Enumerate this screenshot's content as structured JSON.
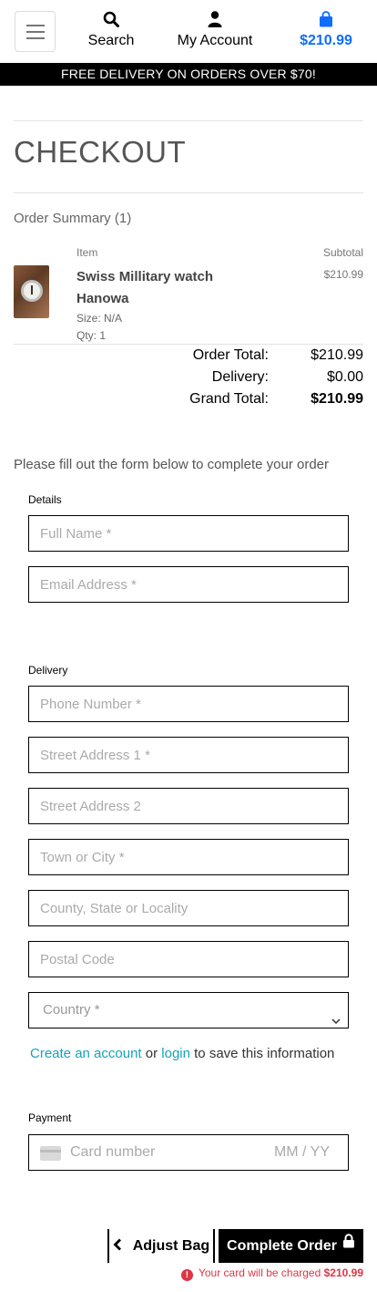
{
  "header": {
    "search_label": "Search",
    "account_label": "My Account",
    "bag_total": "$210.99"
  },
  "banner": {
    "text": "FREE DELIVERY ON ORDERS OVER $70!"
  },
  "page": {
    "title": "CHECKOUT"
  },
  "summary": {
    "title": "Order Summary (1)",
    "item_header": "Item",
    "subtotal_header": "Subtotal",
    "item": {
      "name": "Swiss Millitary watch Hanowa",
      "price": "$210.99",
      "size": "Size: N/A",
      "qty": "Qty: 1"
    },
    "order_total_label": "Order Total:",
    "order_total_value": "$210.99",
    "delivery_label": "Delivery:",
    "delivery_value": "$0.00",
    "grand_total_label": "Grand Total:",
    "grand_total_value": "$210.99"
  },
  "form": {
    "intro": "Please fill out the form below to complete your order",
    "details_label": "Details",
    "full_name_placeholder": "Full Name *",
    "email_placeholder": "Email Address *",
    "delivery_label": "Delivery",
    "phone_placeholder": "Phone Number *",
    "street1_placeholder": "Street Address 1 *",
    "street2_placeholder": "Street Address 2",
    "town_placeholder": "Town or City *",
    "county_placeholder": "County, State or Locality",
    "postcode_placeholder": "Postal Code",
    "country_selected": "Country *",
    "account_link": "Create an account",
    "or_text": "or",
    "login_link": "login",
    "save_text": "to save this information",
    "payment_label": "Payment",
    "card_placeholder": "Card number",
    "expiry_placeholder": "MM / YY"
  },
  "actions": {
    "adjust_bag": "Adjust Bag",
    "complete_order": "Complete Order",
    "charge_note": "Your card will be charged",
    "charge_amount": "$210.99"
  },
  "colors": {
    "bag_total": "#0d6efd",
    "link": "#17a2b8",
    "warning": "#dc3545",
    "banner": "#000000"
  },
  "icons": [
    "menu-icon",
    "search-icon",
    "user-icon",
    "shopping-bag-icon",
    "chevron-left-icon",
    "lock-icon",
    "card-icon",
    "exclamation-icon",
    "chevron-down-icon"
  ]
}
